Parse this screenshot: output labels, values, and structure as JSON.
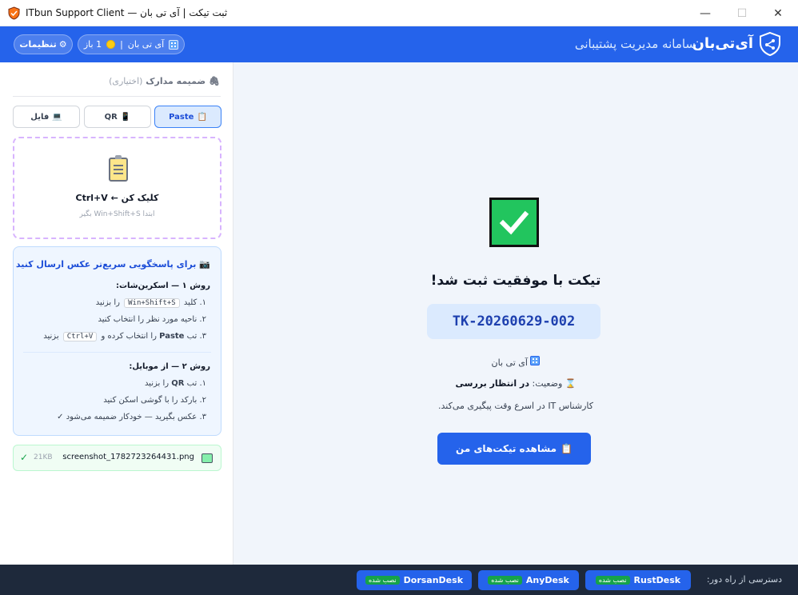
{
  "window": {
    "title": "ITbun Support Client — ثبت تیکت | آی تی بان",
    "minimize": "—",
    "maximize": "☐",
    "close": "✕"
  },
  "header": {
    "brand_name": "آی‌تی‌بان",
    "brand_subtitle": "سامانه مدیریت پشتیبانی",
    "settings_label": "تنظیمات",
    "settings_icon": "⚙",
    "status_org": "آی تی بان",
    "status_sep": "|",
    "status_open": "1 باز",
    "brand_color": "#2563eb"
  },
  "attachments": {
    "title": "ضمیمه مدارک",
    "optional": "(اختیاری)",
    "tabs": [
      {
        "label": "Paste",
        "icon": "clipboard-icon",
        "active": true
      },
      {
        "label": "QR",
        "icon": "phone-icon",
        "active": false
      },
      {
        "label": "فایل",
        "icon": "laptop-icon",
        "active": false
      }
    ],
    "dropzone": {
      "main": "کلیک کن ← Ctrl+V",
      "sub": "ابتدا Win+Shift+S بگیر"
    }
  },
  "guide": {
    "title": "برای پاسخگویی سریع‌تر عکس ارسال کنید",
    "method1_title": "روش ۱ — اسکرین‌شات:",
    "m1_step1_pre": "۱. کلید",
    "m1_step1_key": "Win+Shift+S",
    "m1_step1_post": "را بزنید",
    "m1_step2": "۲. ناحیه مورد نظر را انتخاب کنید",
    "m1_step3_pre": "۳. تب",
    "m1_step3_tab": "Paste",
    "m1_step3_mid": "را انتخاب کرده و",
    "m1_step3_key": "Ctrl+V",
    "m1_step3_post": "بزنید",
    "method2_title": "روش ۲ — از موبایل:",
    "m2_step1_pre": "۱. تب",
    "m2_step1_tab": "QR",
    "m2_step1_post": "را بزنید",
    "m2_step2": "۲. بارکد را با گوشی اسکن کنید",
    "m2_step3": "۳. عکس بگیرید — خودکار ضمیمه می‌شود ✓"
  },
  "file": {
    "name": "screenshot_1782723264431.png",
    "size": "21KB",
    "check": "✓"
  },
  "main": {
    "success_title": "تیکت با موفقیت ثبت شد!",
    "ticket_id": "TK-20260629-002",
    "org": "آی تی بان",
    "status_label": "وضعیت:",
    "status_value": "در انتظار بررسی",
    "followup": "کارشناس IT در اسرع وقت پیگیری می‌کند.",
    "view_button": "مشاهده تیکت‌های من",
    "success_color": "#22c55e"
  },
  "footer": {
    "label": "دسترسی از راه دور:",
    "tools": [
      {
        "name": "RustDesk",
        "badge": "نصب شده"
      },
      {
        "name": "AnyDesk",
        "badge": "نصب شده"
      },
      {
        "name": "DorsanDesk",
        "badge": "نصب شده"
      }
    ]
  }
}
